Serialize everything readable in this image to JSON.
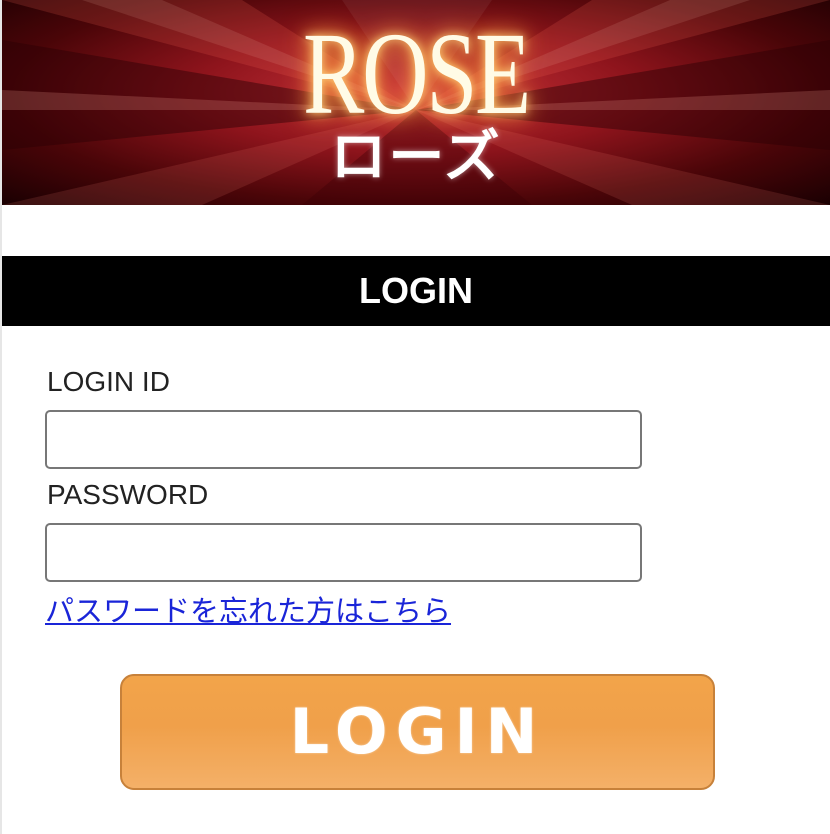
{
  "banner": {
    "title": "ROSE",
    "subtitle": "ローズ"
  },
  "section": {
    "title": "LOGIN"
  },
  "form": {
    "login_id_label": "LOGIN ID",
    "login_id_value": "",
    "password_label": "PASSWORD",
    "password_value": "",
    "forgot_link": "パスワードを忘れた方はこちら",
    "submit_label": "LOGIN"
  },
  "colors": {
    "banner_red": "#8e141c",
    "bar_black": "#000000",
    "button_orange": "#f0a04a",
    "link_blue": "#1a25d8"
  }
}
